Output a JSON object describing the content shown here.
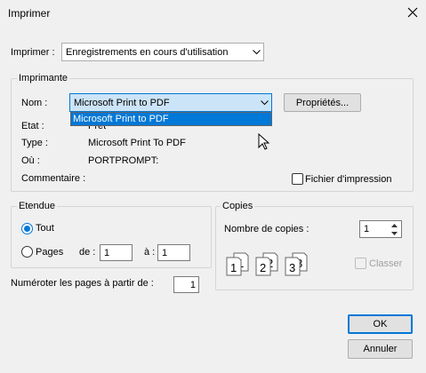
{
  "dialog": {
    "title": "Imprimer"
  },
  "printer_select": {
    "label": "Imprimer :",
    "value": "Enregistrements en cours d'utilisation"
  },
  "printer_group": {
    "title": "Imprimante",
    "name_label": "Nom :",
    "name_value": "Microsoft Print to PDF",
    "dropdown_option": "Microsoft Print to PDF",
    "properties_button": "Propriétés...",
    "status_label": "Etat :",
    "status_value": "Prêt",
    "type_label": "Type :",
    "type_value": "Microsoft Print To PDF",
    "where_label": "Où :",
    "where_value": "PORTPROMPT:",
    "comment_label": "Commentaire :",
    "print_to_file_label": "Fichier d'impression"
  },
  "range_group": {
    "title": "Etendue",
    "all_label": "Tout",
    "pages_label": "Pages",
    "from_label": "de :",
    "from_value": "1",
    "to_label": "à :",
    "to_value": "1"
  },
  "copies_group": {
    "title": "Copies",
    "count_label": "Nombre de copies :",
    "count_value": "1",
    "collate_label": "Classer"
  },
  "start_page": {
    "label": "Numéroter les pages à partir de :",
    "value": "1"
  },
  "buttons": {
    "ok": "OK",
    "cancel": "Annuler"
  },
  "colors": {
    "accent": "#0078d7",
    "background": "#f0f0f0"
  }
}
